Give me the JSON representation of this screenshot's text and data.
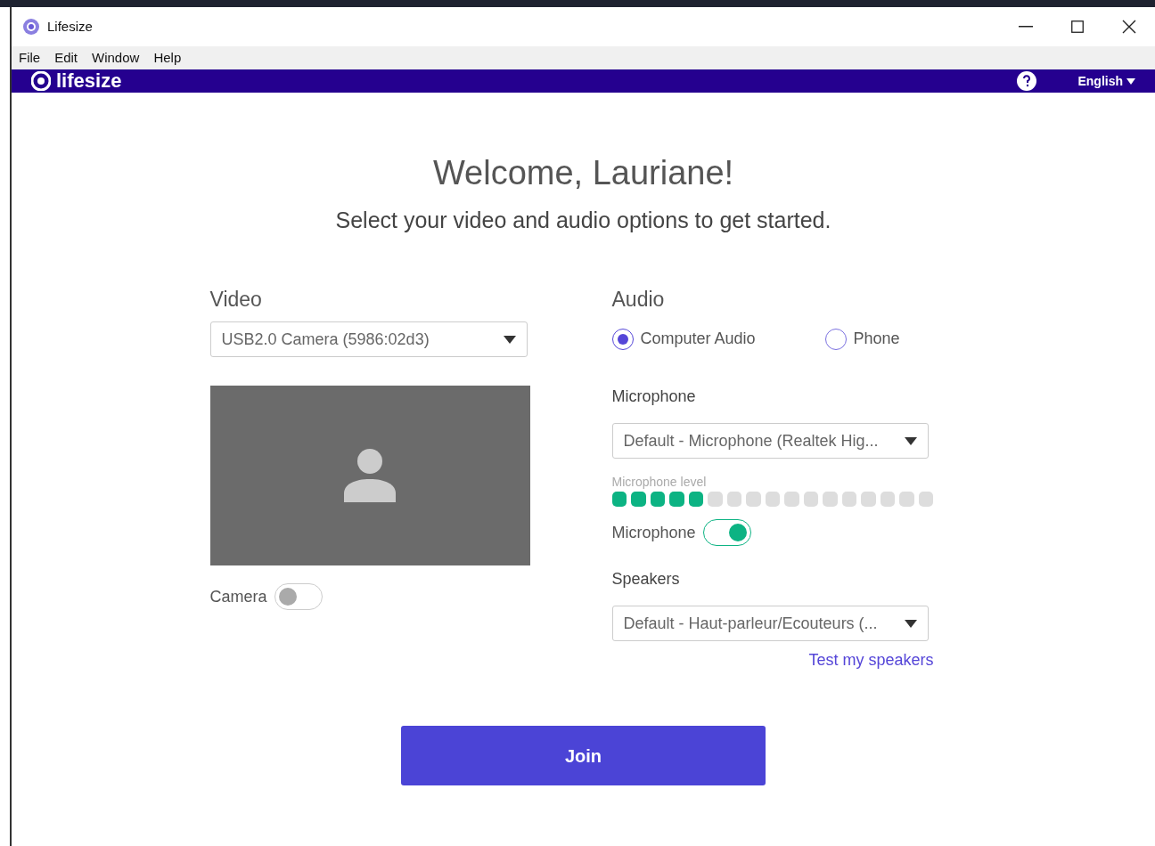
{
  "window": {
    "title": "Lifesize"
  },
  "menu": [
    "File",
    "Edit",
    "Window",
    "Help"
  ],
  "header": {
    "logo": "lifesize",
    "language": "English"
  },
  "heading": "Welcome, Lauriane!",
  "subheading": "Select your video and audio options to get started.",
  "video": {
    "title": "Video",
    "camera_select": "USB2.0 Camera (5986:02d3)",
    "camera_label": "Camera",
    "camera_on": false
  },
  "audio": {
    "title": "Audio",
    "options": [
      {
        "label": "Computer Audio",
        "selected": true
      },
      {
        "label": "Phone",
        "selected": false
      }
    ],
    "microphone_title": "Microphone",
    "microphone_select": "Default - Microphone (Realtek Hig...",
    "level_label": "Microphone level",
    "level": 0.294,
    "microphone_label": "Microphone",
    "microphone_on": true,
    "speakers_title": "Speakers",
    "speakers_select": "Default - Haut-parleur/Ecouteurs (...",
    "test_link": "Test my speakers"
  },
  "join_button": "Join"
}
